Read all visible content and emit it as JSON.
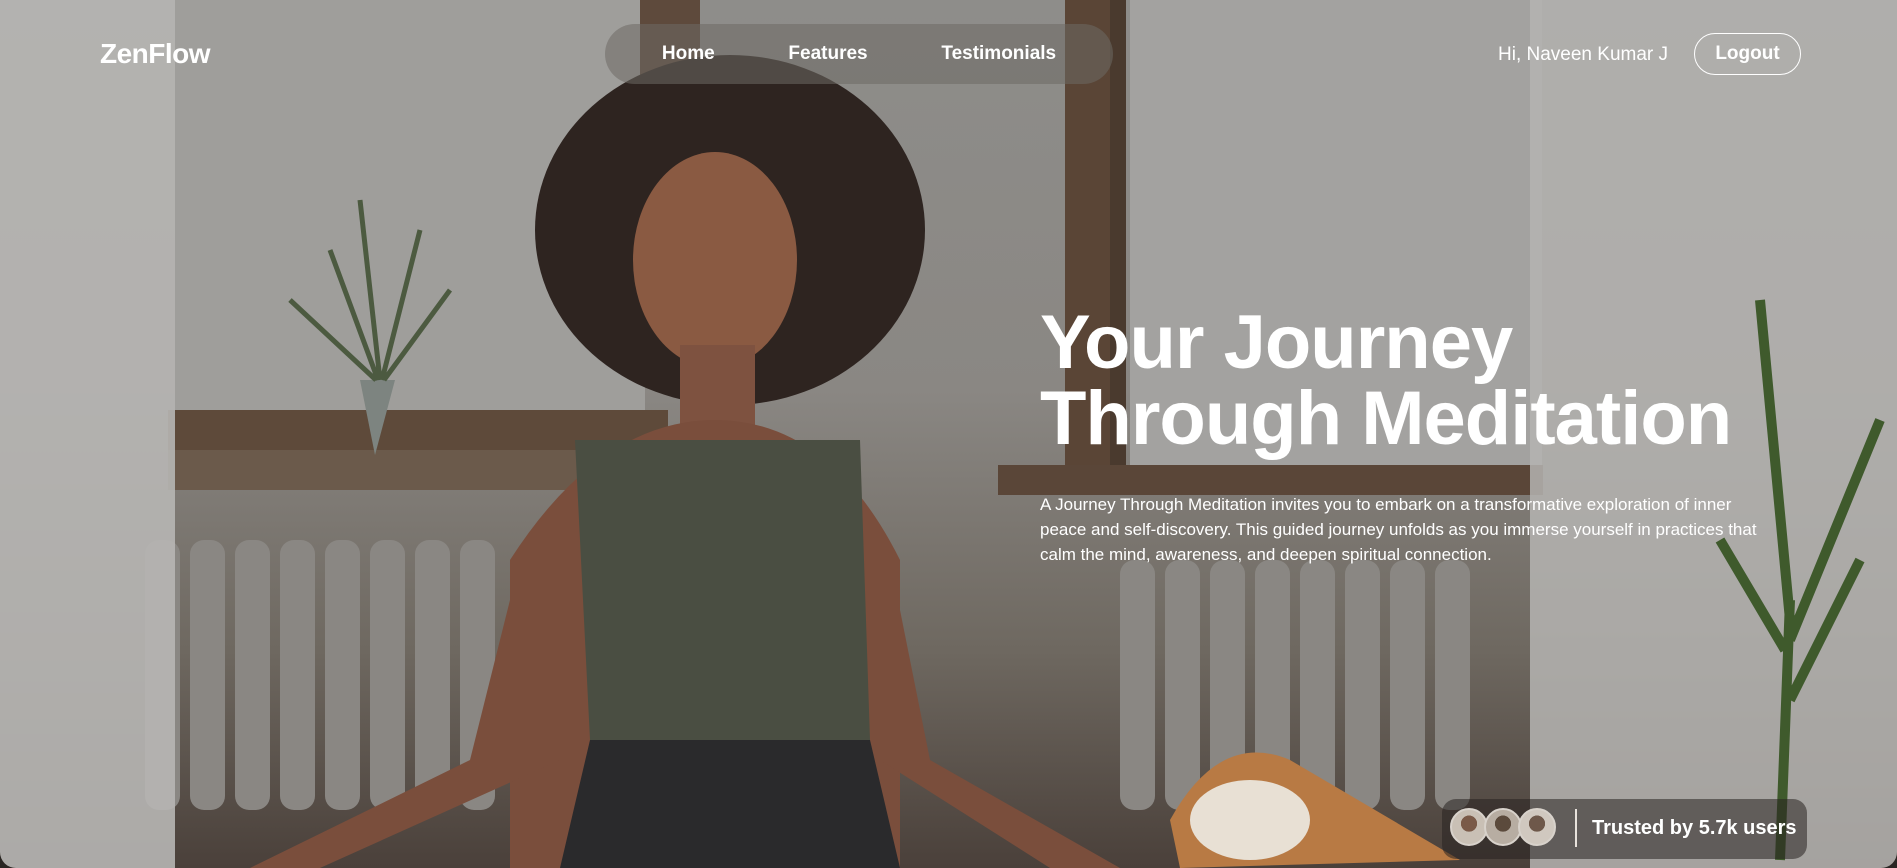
{
  "header": {
    "logo": "ZenFlow",
    "nav": [
      "Home",
      "Features",
      "Testimonials"
    ],
    "greeting": "Hi, Naveen Kumar J",
    "logout_label": "Logout"
  },
  "hero": {
    "title_line1": "Your Journey",
    "title_line2": "Through Meditation",
    "description": "A Journey Through Meditation invites you to embark on a transformative exploration of inner peace and self-discovery. This guided journey unfolds as you immerse yourself in practices that calm the mind, awareness, and deepen spiritual connection.",
    "background": "woman meditating in lotus pose beside a window with a dog"
  },
  "trust": {
    "text": "Trusted by 5.7k users",
    "avatars": [
      "user-avatar-1",
      "user-avatar-2",
      "user-avatar-3"
    ]
  }
}
